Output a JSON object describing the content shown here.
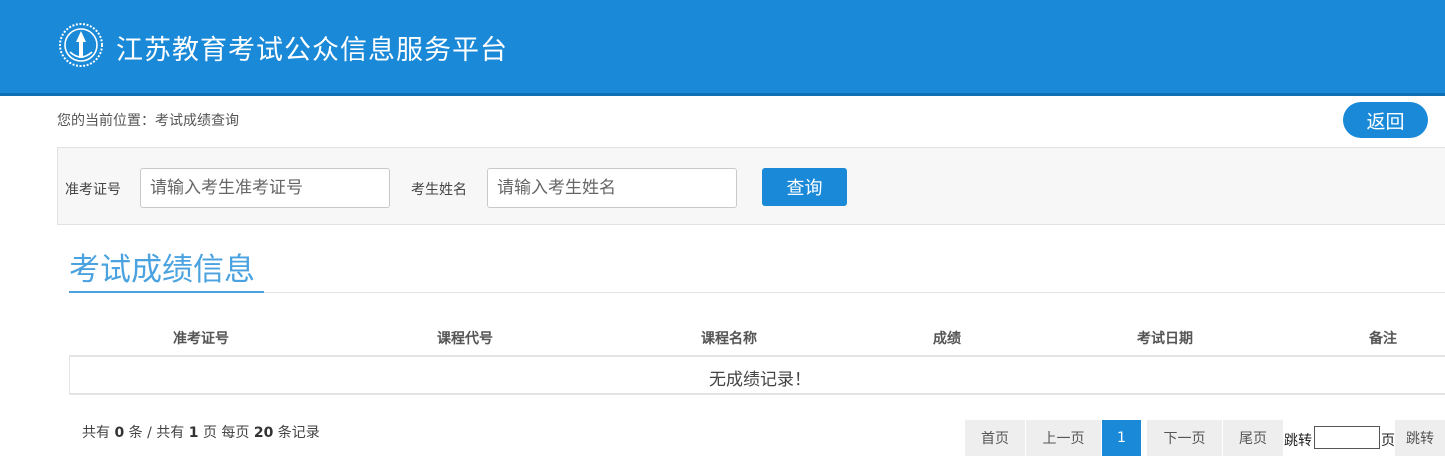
{
  "header": {
    "title": "江苏教育考试公众信息服务平台",
    "bg_color": "#1989d8",
    "logo_icon": "emblem-logo-icon"
  },
  "breadcrumb": "您的当前位置：考试成绩查询",
  "back_button": "返回",
  "search": {
    "exam_no_label": "准考证号",
    "exam_no_placeholder": "请输入考生准考证号",
    "exam_no_value": "",
    "name_label": "考生姓名",
    "name_placeholder": "请输入考生姓名",
    "name_value": "",
    "query_button": "查询"
  },
  "section_title": "考试成绩信息",
  "table": {
    "columns": [
      "准考证号",
      "课程代号",
      "课程名称",
      "成绩",
      "考试日期",
      "备注"
    ],
    "rows": [],
    "empty_text": "无成绩记录！"
  },
  "pagination": {
    "info_prefix": "共有",
    "total_records": "0",
    "info_records_unit": "条 / 共有",
    "total_pages": "1",
    "info_pages_unit": "页 每页",
    "per_page": "20",
    "info_suffix": "条记录",
    "first": "首页",
    "prev": "上一页",
    "current_page": "1",
    "next": "下一页",
    "last": "尾页",
    "jump_prefix": "跳转",
    "jump_value": "",
    "jump_suffix": "页",
    "jump_button": "跳转"
  },
  "accent_color": "#1a8ad8"
}
